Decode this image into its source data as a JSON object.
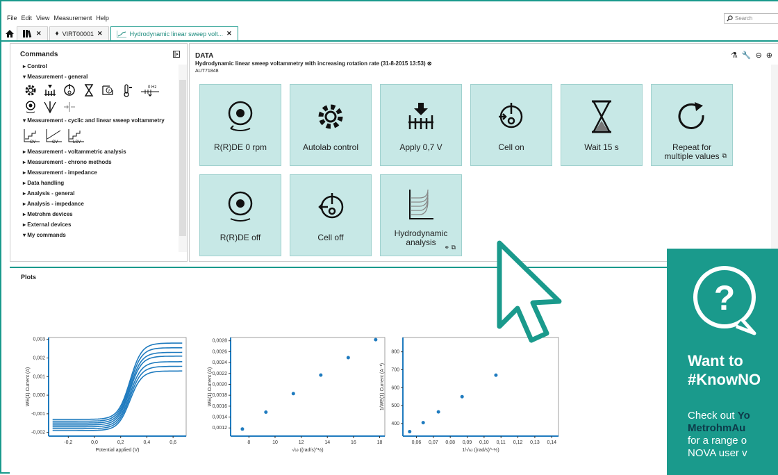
{
  "menu": [
    "File",
    "Edit",
    "View",
    "Measurement",
    "Help"
  ],
  "search_placeholder": "Search",
  "tabs": [
    {
      "label": ""
    },
    {
      "label": "VIRT00001"
    },
    {
      "label": "Hydrodynamic linear sweep volt..."
    }
  ],
  "commands": {
    "title": "Commands",
    "items": [
      "Control",
      "Measurement - general",
      "Measurement - cyclic and linear sweep voltammetry",
      "Measurement - voltammetric analysis",
      "Measurement - chrono methods",
      "Measurement - impedance",
      "Data handling",
      "Analysis - general",
      "Analysis - impedance",
      "Metrohm devices",
      "External devices",
      "My commands"
    ],
    "cv_labels": [
      "CV",
      "CV",
      "LSV"
    ],
    "hz_label": "0 Hz"
  },
  "data": {
    "title": "DATA",
    "procedure": "Hydrodynamic linear sweep voltammetry with increasing rotation rate (31-8-2015 13:53)",
    "instrument": "AUT71848",
    "tiles": [
      "R(R)DE 0 rpm",
      "Autolab control",
      "Apply 0,7 V",
      "Cell on",
      "Wait 15 s",
      "Repeat for multiple values",
      "R(R)DE off",
      "Cell off",
      "Hydrodynamic analysis"
    ]
  },
  "plots": {
    "title": "Plots",
    "plot1": {
      "ylabel": "WE(1).Current (A)",
      "xlabel": "Potential applied (V)",
      "yticks": [
        "0,003",
        "0,002",
        "0,001",
        "0,000",
        "-0,001",
        "-0,002"
      ],
      "xticks": [
        "-0,2",
        "0,0",
        "0,2",
        "0,4",
        "0,6"
      ]
    },
    "plot2": {
      "ylabel": "WE(1).Current (A)",
      "xlabel": "√ω ((rad/s)^½)",
      "yticks": [
        "0,0028",
        "0,0026",
        "0,0024",
        "0,0022",
        "0,0020",
        "0,0018",
        "0,0016",
        "0,0014",
        "0,0012"
      ],
      "xticks": [
        "8",
        "10",
        "12",
        "14",
        "16",
        "18"
      ]
    },
    "plot3": {
      "ylabel": "1/WE(1).Current (A⁻¹)",
      "xlabel": "1/√ω ((rad/s)^-½)",
      "yticks": [
        "800",
        "700",
        "600",
        "500",
        "400"
      ],
      "xticks": [
        "0,06",
        "0,07",
        "0,08",
        "0,09",
        "0,10",
        "0,11",
        "0,12",
        "0,13",
        "0,14"
      ]
    }
  },
  "chart_data": [
    {
      "type": "line",
      "xlabel": "Potential applied (V)",
      "ylabel": "WE(1).Current (A)",
      "xlim": [
        -0.35,
        0.7
      ],
      "ylim": [
        -0.0022,
        0.0031
      ]
    },
    {
      "type": "scatter",
      "xlabel": "√ω ((rad/s)^½)",
      "ylabel": "WE(1).Current (A)",
      "x": [
        7.5,
        9.3,
        11.4,
        13.5,
        15.6,
        17.7
      ],
      "y": [
        0.00118,
        0.00149,
        0.00183,
        0.00217,
        0.00249,
        0.00282
      ]
    },
    {
      "type": "scatter",
      "xlabel": "1/√ω ((rad/s)^-½)",
      "ylabel": "1/WE(1).Current (A⁻¹)",
      "x": [
        0.056,
        0.064,
        0.073,
        0.087,
        0.107
      ],
      "y": [
        355,
        405,
        465,
        550,
        670
      ]
    }
  ],
  "promo": {
    "line1": "Want to",
    "line2": "#KnowNO",
    "body1": "Check out ",
    "body1b": "Yo",
    "body2b": "MetrohmAu",
    "body3": "for a range o",
    "body4": "NOVA user v"
  },
  "colors": {
    "accent": "#1a9a8c",
    "tile": "#c7e8e6",
    "series": "#1f7bbf"
  }
}
